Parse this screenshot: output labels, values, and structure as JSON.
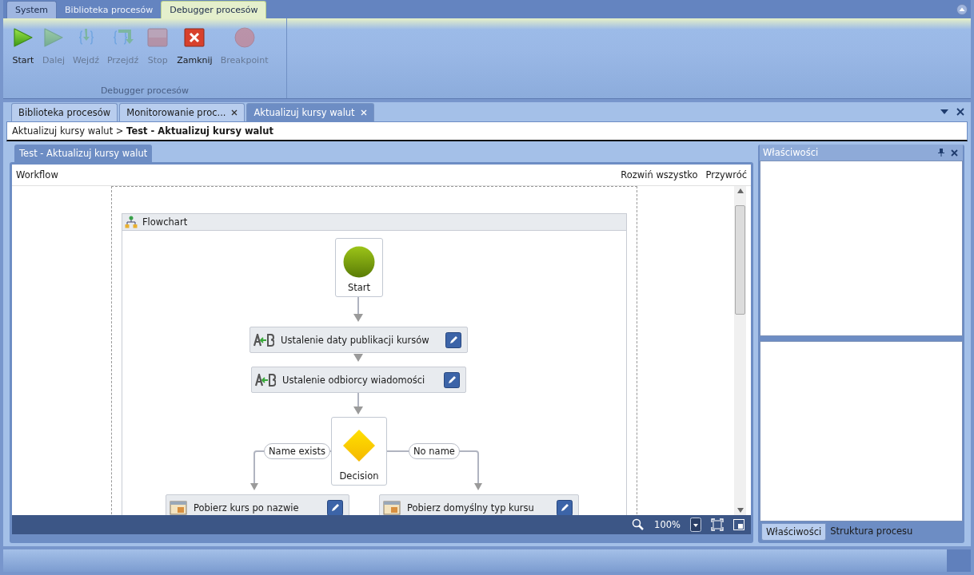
{
  "ribbon_tabs": [
    {
      "label": "System",
      "selected": false
    },
    {
      "label": "Biblioteka procesów",
      "selected": false
    },
    {
      "label": "Debugger procesów",
      "selected": true
    }
  ],
  "ribbon": {
    "buttons": [
      {
        "label": "Start",
        "kind": "play",
        "disabled": false
      },
      {
        "label": "Dalej",
        "kind": "play",
        "disabled": true
      },
      {
        "label": "Wejdź",
        "kind": "step-into",
        "disabled": true
      },
      {
        "label": "Przejdź",
        "kind": "step-over",
        "disabled": true
      },
      {
        "label": "Stop",
        "kind": "stop",
        "disabled": true
      },
      {
        "label": "Zamknij",
        "kind": "close",
        "disabled": false
      },
      {
        "label": "Breakpoint",
        "kind": "breakpoint",
        "disabled": true
      }
    ],
    "group_label": "Debugger procesów"
  },
  "doc_tabs": [
    {
      "label": "Biblioteka procesów",
      "selected": false,
      "closable": false
    },
    {
      "label": "Monitorowanie proc...",
      "selected": false,
      "closable": true
    },
    {
      "label": "Aktualizuj kursy walut",
      "selected": true,
      "closable": true
    }
  ],
  "breadcrumb": {
    "parent": "Aktualizuj kursy walut",
    "separator": ">",
    "current": "Test - Aktualizuj kursy walut"
  },
  "designer": {
    "tab": "Test - Aktualizuj kursy walut",
    "title": "Workflow",
    "actions": [
      "Rozwiń wszystko",
      "Przywróć"
    ],
    "flowchart": {
      "title": "Flowchart",
      "start": "Start",
      "activities": [
        {
          "label": "Ustalenie daty publikacji kursów",
          "kind": "assign"
        },
        {
          "label": "Ustalenie odbiorcy wiadomości",
          "kind": "assign"
        }
      ],
      "decision": "Decision",
      "branches": [
        {
          "label": "Name exists",
          "activity": {
            "label": "Pobierz kurs po nazwie",
            "kind": "query"
          }
        },
        {
          "label": "No name",
          "activity": {
            "label": "Pobierz domyślny typ kursu",
            "kind": "query"
          }
        }
      ]
    },
    "zoom": "100%"
  },
  "properties": {
    "title": "Właściwości",
    "tabs": [
      {
        "label": "Właściwości",
        "selected": true
      },
      {
        "label": "Struktura procesu",
        "selected": false
      }
    ]
  }
}
